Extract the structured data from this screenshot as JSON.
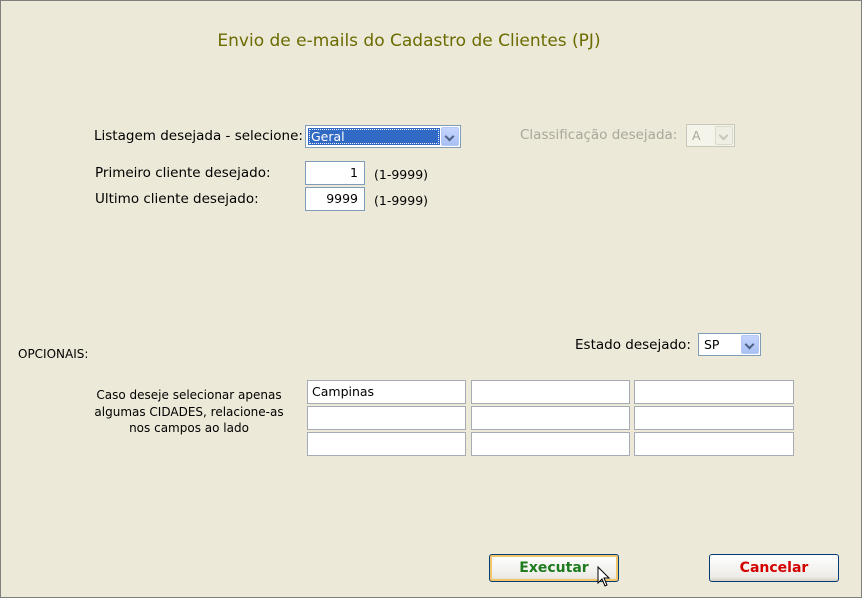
{
  "title": "Envio de e-mails do Cadastro de Clientes (PJ)",
  "listagem": {
    "label": "Listagem desejada - selecione:",
    "value": "Geral"
  },
  "classificacao": {
    "label": "Classificação desejada:",
    "value": "A"
  },
  "primeiro": {
    "label": "Primeiro cliente desejado:",
    "value": "1",
    "range": "(1-9999)"
  },
  "ultimo": {
    "label": "Ultimo cliente desejado:",
    "value": "9999",
    "range": "(1-9999)"
  },
  "opcionais": {
    "label": "OPCIONAIS:"
  },
  "estado": {
    "label": "Estado desejado:",
    "value": "SP"
  },
  "cidades": {
    "note": "Caso deseje selecionar apenas algumas CIDADES, relacione-as nos campos ao lado",
    "values": [
      "Campinas",
      "",
      "",
      "",
      "",
      "",
      "",
      "",
      ""
    ]
  },
  "buttons": {
    "executar": "Executar",
    "cancelar": "Cancelar"
  },
  "colors": {
    "title": "#6b6b00",
    "executar": "#1e7b1e",
    "cancelar": "#d40000",
    "background": "#ece9d8"
  },
  "icons": {
    "cursor": "mouse-pointer-icon"
  }
}
